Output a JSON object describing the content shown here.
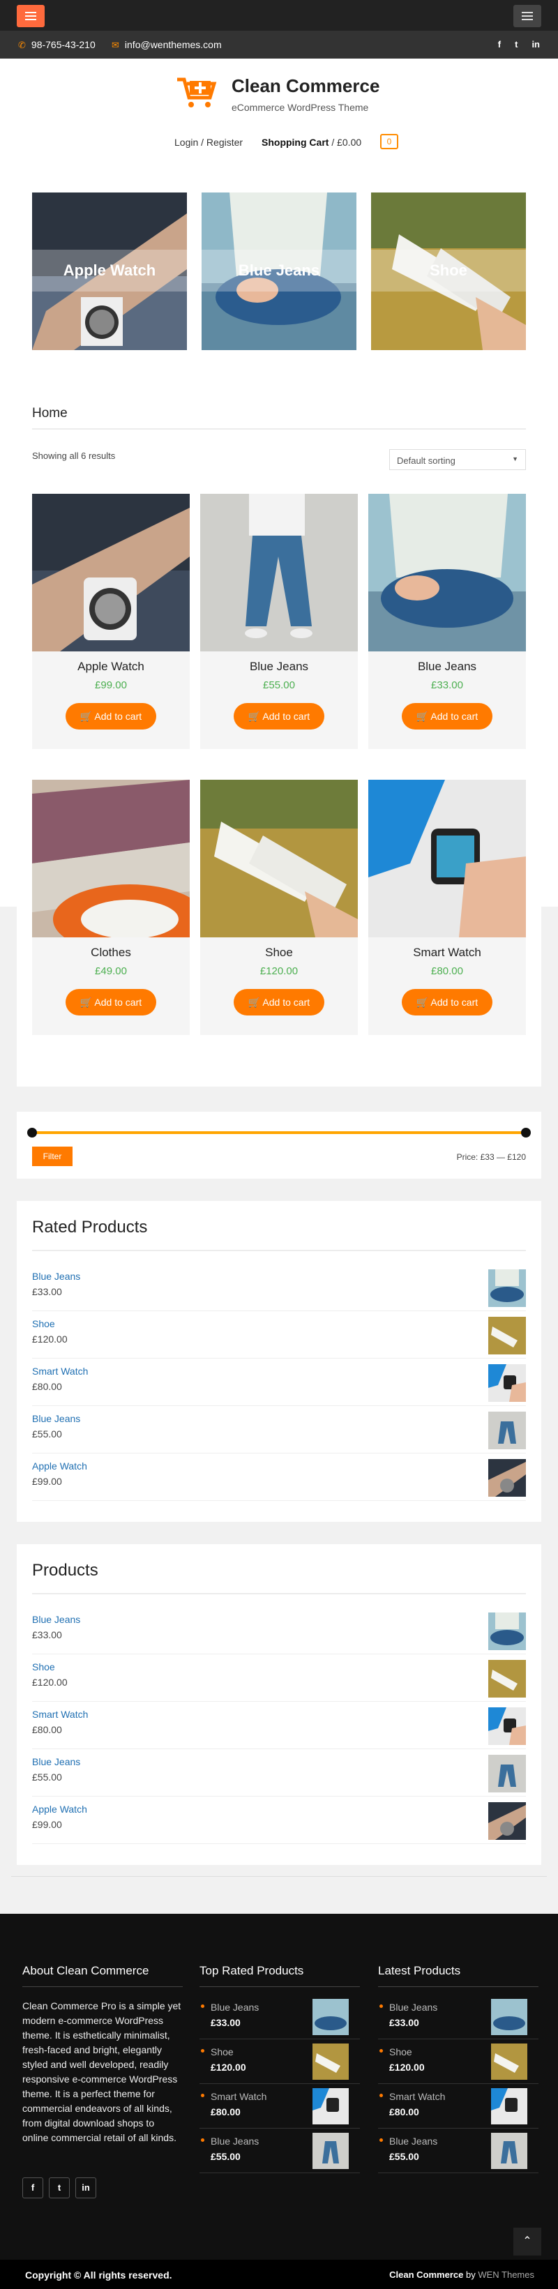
{
  "topbar": {
    "phone": "98-765-43-210",
    "email": "info@wenthemes.com",
    "social": [
      "f",
      "t",
      "in"
    ]
  },
  "header": {
    "title": "Clean Commerce",
    "tagline": "eCommerce WordPress Theme",
    "account": "Login / Register",
    "cart_label": "Shopping Cart",
    "cart_total": "/ £0.00",
    "cart_count": "0"
  },
  "categories": [
    "Apple Watch",
    "Blue Jeans",
    "Shoe"
  ],
  "shop": {
    "breadcrumb": "Home",
    "result_count": "Showing all 6 results",
    "sorting": "Default sorting",
    "products": [
      {
        "name": "Apple Watch",
        "price": "£99.00",
        "button": "Add to cart"
      },
      {
        "name": "Blue Jeans",
        "price": "£55.00",
        "button": "Add to cart"
      },
      {
        "name": "Blue Jeans",
        "price": "£33.00",
        "button": "Add to cart"
      },
      {
        "name": "Clothes",
        "price": "£49.00",
        "button": "Add to cart"
      },
      {
        "name": "Shoe",
        "price": "£120.00",
        "button": "Add to cart"
      },
      {
        "name": "Smart Watch",
        "price": "£80.00",
        "button": "Add to cart"
      }
    ]
  },
  "price_filter": {
    "button": "Filter",
    "label": "Price: £33 — £120",
    "min_pct": 0,
    "max_pct": 100
  },
  "rated": {
    "title": "Rated Products",
    "items": [
      {
        "name": "Blue Jeans",
        "price": "£33.00"
      },
      {
        "name": "Shoe",
        "price": "£120.00"
      },
      {
        "name": "Smart Watch",
        "price": "£80.00"
      },
      {
        "name": "Blue Jeans",
        "price": "£55.00"
      },
      {
        "name": "Apple Watch",
        "price": "£99.00"
      }
    ]
  },
  "products_widget": {
    "title": "Products",
    "items": [
      {
        "name": "Blue Jeans",
        "price": "£33.00"
      },
      {
        "name": "Shoe",
        "price": "£120.00"
      },
      {
        "name": "Smart Watch",
        "price": "£80.00"
      },
      {
        "name": "Blue Jeans",
        "price": "£55.00"
      },
      {
        "name": "Apple Watch",
        "price": "£99.00"
      }
    ]
  },
  "footer": {
    "about_title": "About Clean Commerce",
    "about_text": "Clean Commerce Pro is a simple yet modern e-commerce WordPress theme. It is esthetically minimalist, fresh-faced and bright, elegantly styled and well developed, readily responsive e-commerce WordPress theme. It is a perfect theme for commercial endeavors of all kinds, from digital download shops to online commercial retail of all kinds.",
    "top_title": "Top Rated Products",
    "top_items": [
      {
        "name": "Blue Jeans",
        "price": "£33.00"
      },
      {
        "name": "Shoe",
        "price": "£120.00"
      },
      {
        "name": "Smart Watch",
        "price": "£80.00"
      },
      {
        "name": "Blue Jeans",
        "price": "£55.00"
      }
    ],
    "latest_title": "Latest Products",
    "latest_items": [
      {
        "name": "Blue Jeans",
        "price": "£33.00"
      },
      {
        "name": "Shoe",
        "price": "£120.00"
      },
      {
        "name": "Smart Watch",
        "price": "£80.00"
      },
      {
        "name": "Blue Jeans",
        "price": "£55.00"
      }
    ],
    "social": [
      "f",
      "t",
      "in"
    ],
    "copyright": "Copyright © All rights reserved.",
    "credit_theme": "Clean Commerce",
    "credit_by": "by",
    "credit_author": "WEN Themes"
  },
  "colors": {
    "accent": "#ff7a00",
    "price": "#4caf50",
    "dark": "#111111"
  }
}
